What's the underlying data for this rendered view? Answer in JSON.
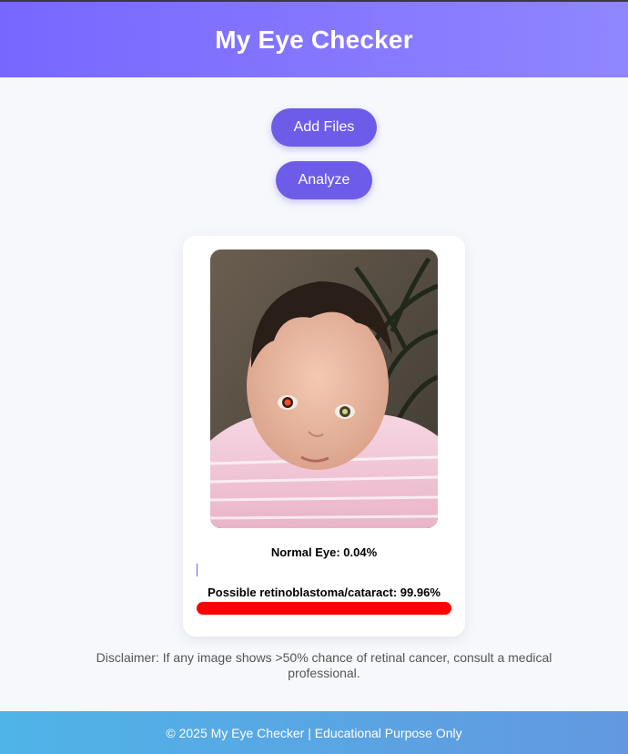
{
  "header": {
    "title": "My Eye Checker"
  },
  "actions": {
    "add_files_label": "Add Files",
    "analyze_label": "Analyze"
  },
  "result": {
    "image_alt": "Uploaded photo of a baby",
    "normal_label": "Normal Eye: 0.04%",
    "normal_value": 0.04,
    "risk_label": "Possible retinoblastoma/cataract: 99.96%",
    "risk_value": 99.96
  },
  "disclaimer": "Disclaimer: If any image shows >50% chance of retinal cancer, consult a medical professional.",
  "footer": {
    "text": "© 2025 My Eye Checker | Educational Purpose Only"
  },
  "colors": {
    "header_start": "#7867ff",
    "header_end": "#8f86ff",
    "button": "#6c5ce7",
    "normal_bar": "#6c5ce7",
    "risk_bar": "#ff0000",
    "footer_start": "#4fb4e8",
    "footer_end": "#6398e0"
  }
}
